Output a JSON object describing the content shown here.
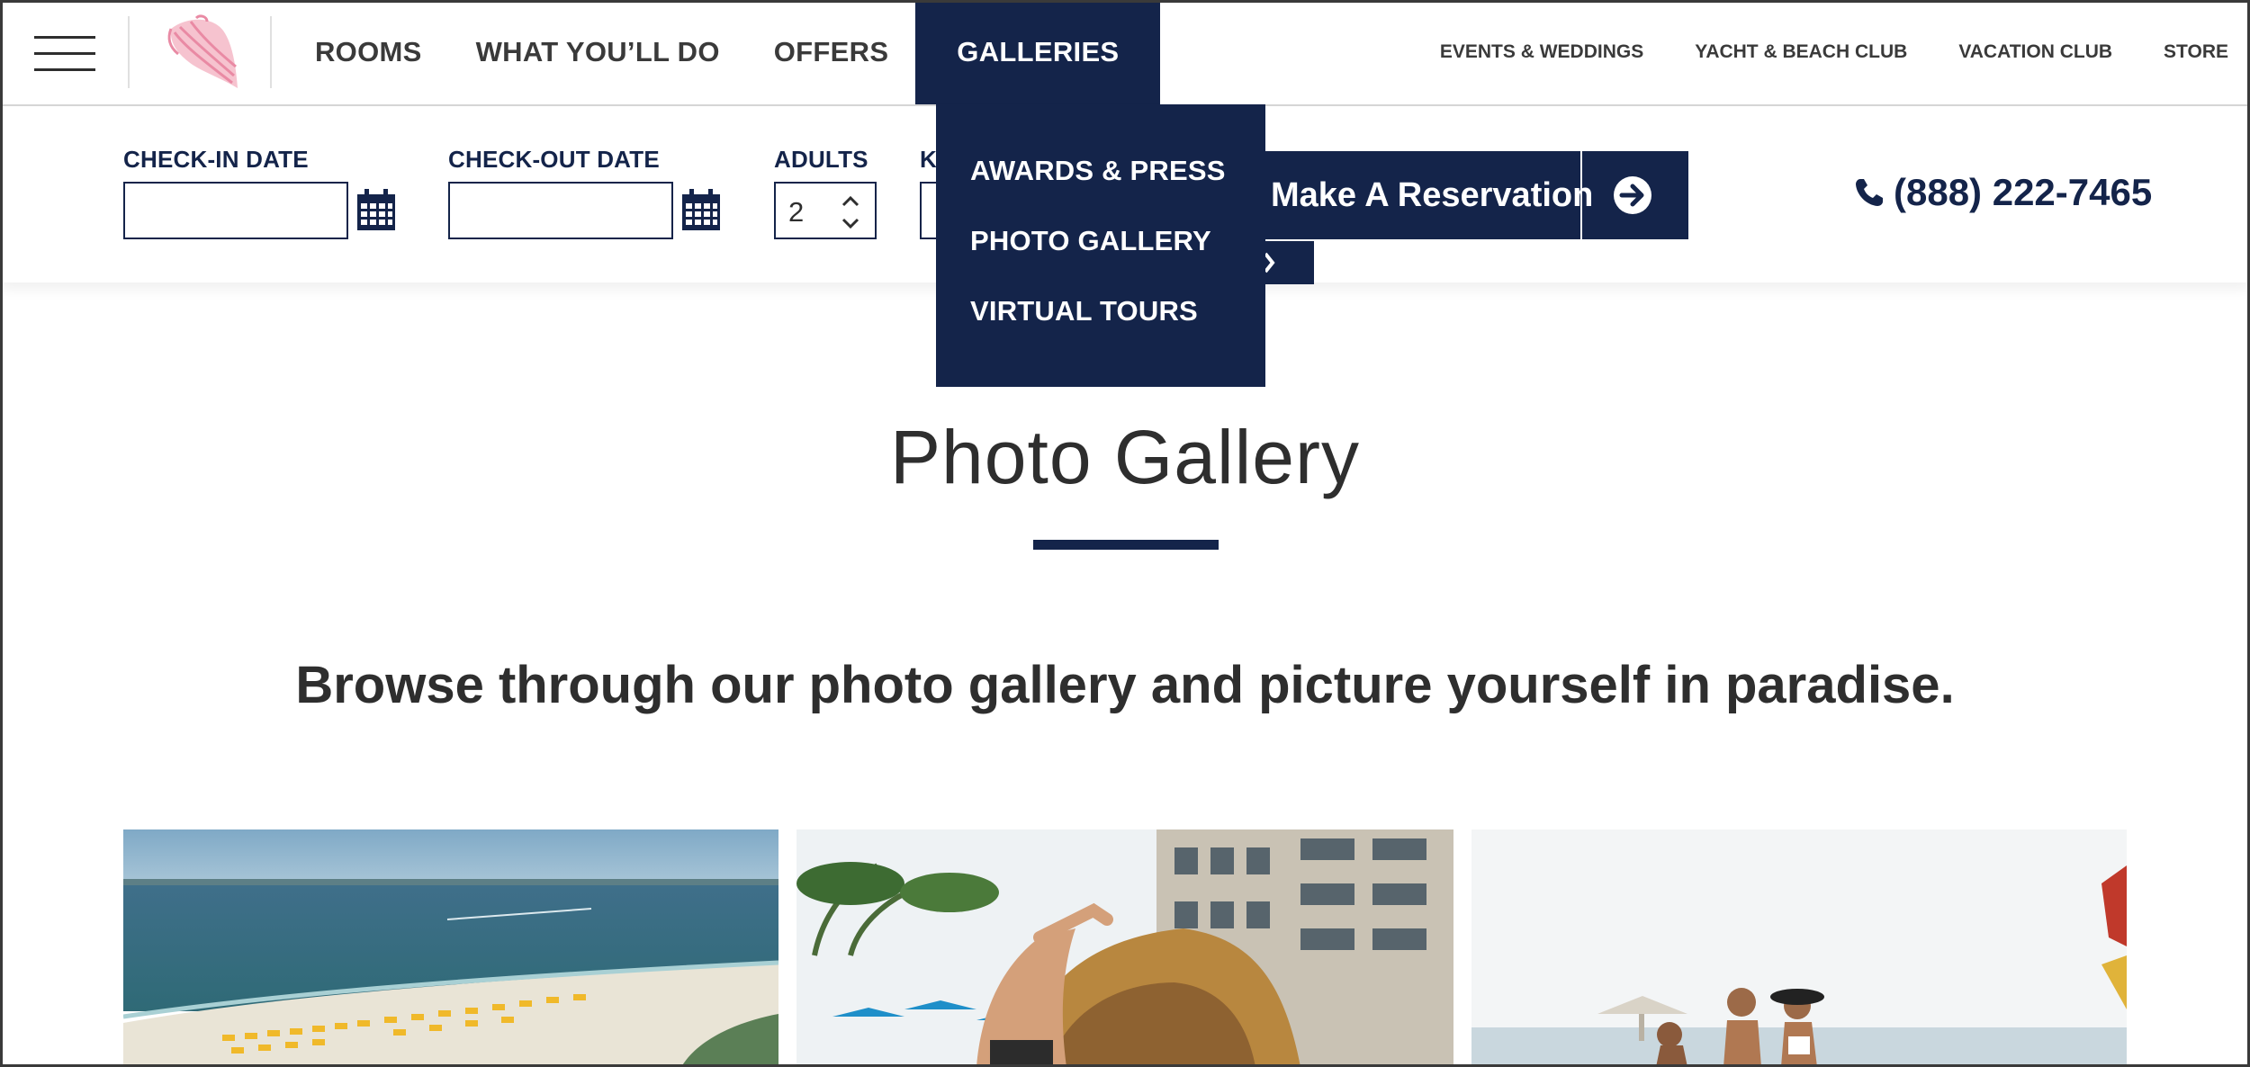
{
  "header": {
    "main_nav": [
      {
        "label": "ROOMS",
        "active": false
      },
      {
        "label": "WHAT YOU’LL DO",
        "active": false
      },
      {
        "label": "OFFERS",
        "active": false
      },
      {
        "label": "GALLERIES",
        "active": true
      }
    ],
    "utility_nav": [
      "EVENTS & WEDDINGS",
      "YACHT & BEACH CLUB",
      "VACATION CLUB",
      "STORE"
    ],
    "logo_icon": "conch-shell-logo",
    "colors": {
      "navy": "#14244a",
      "logo_pink": "#f2a5b8"
    }
  },
  "booking": {
    "check_in_label": "CHECK-IN DATE",
    "check_in_value": "",
    "check_out_label": "CHECK-OUT DATE",
    "check_out_value": "",
    "adults_label": "ADULTS",
    "adults_value": "2",
    "partial_label": "K",
    "reservation_label": "Make A Reservation",
    "phone": "(888) 222-7465"
  },
  "galleries_menu": [
    "AWARDS & PRESS",
    "PHOTO GALLERY",
    "VIRTUAL TOURS"
  ],
  "page": {
    "title": "Photo Gallery",
    "subtitle": "Browse through our photo gallery and picture yourself in paradise."
  },
  "gallery": {
    "photos": [
      "beach-aerial-photo",
      "pool-waterfall-photo",
      "beach-friends-photo"
    ]
  }
}
